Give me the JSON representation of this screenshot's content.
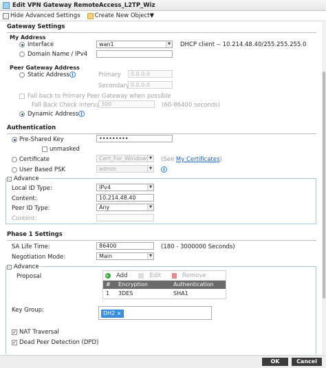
{
  "window": {
    "title": "Edit VPN Gateway RemoteAccess_L2TP_Wiz"
  },
  "toolbar": {
    "hide_advanced": "Hide Advanced Settings",
    "create_object": "Create New Object▼"
  },
  "gateway": {
    "section_title": "Gateway Settings",
    "my_address": {
      "title": "My Address",
      "interface_label": "Interface",
      "interface_value": "wan1",
      "dhcp_info": "DHCP client -- 10.214.48.40/255.255.255.0",
      "domain_label": "Domain Name / IPv4"
    },
    "peer": {
      "title": "Peer Gateway Address",
      "static_label": "Static Address",
      "primary_label": "Primary",
      "primary_value": "0.0.0.0",
      "secondary_label": "Secondary",
      "secondary_value": "0.0.0.0",
      "fallback_label": "Fall back to Primary Peer Gateway when possible",
      "fallback_interval_label": "Fall Back Check Interval:",
      "fallback_interval_value": "300",
      "fallback_range": "(60-86400 seconds)",
      "dynamic_label": "Dynamic Address"
    }
  },
  "auth": {
    "section_title": "Authentication",
    "psk_label": "Pre-Shared Key",
    "psk_value": "•••••••••",
    "unmasked_label": "unmasked",
    "cert_label": "Certificate",
    "cert_value": "Cert_For_Windows",
    "see_prefix": "(See ",
    "see_link": "My Certificates",
    "see_suffix": ")",
    "user_psk_label": "User Based PSK",
    "user_psk_value": "admin",
    "advance_label": "Advance",
    "local_id_type_label": "Local ID Type:",
    "local_id_type_value": "IPv4",
    "content_label": "Content:",
    "content_value": "10.214.48.40",
    "peer_id_type_label": "Peer ID Type:",
    "peer_id_type_value": "Any",
    "peer_content_label": "Content:"
  },
  "phase1": {
    "section_title": "Phase 1 Settings",
    "sa_life_label": "SA Life Time:",
    "sa_life_value": "86400",
    "sa_life_range": "(180 - 3000000 Seconds)",
    "negotiation_label": "Negotiation Mode:",
    "negotiation_value": "Main",
    "advance_label": "Advance",
    "proposal_label": "Proposal",
    "add_label": "Add",
    "edit_label": "Edit",
    "remove_label": "Remove",
    "columns": [
      "#",
      "Encryption",
      "Authentication"
    ],
    "rows": [
      {
        "num": "1",
        "encryption": "3DES",
        "auth": "SHA1"
      }
    ],
    "key_group_label": "Key Group:",
    "key_group_tag": "DH2 ×",
    "nat_label": "NAT Traversal",
    "dpd_label": "Dead Peer Detection (DPD)"
  },
  "footer": {
    "ok": "OK",
    "cancel": "Cancel"
  }
}
